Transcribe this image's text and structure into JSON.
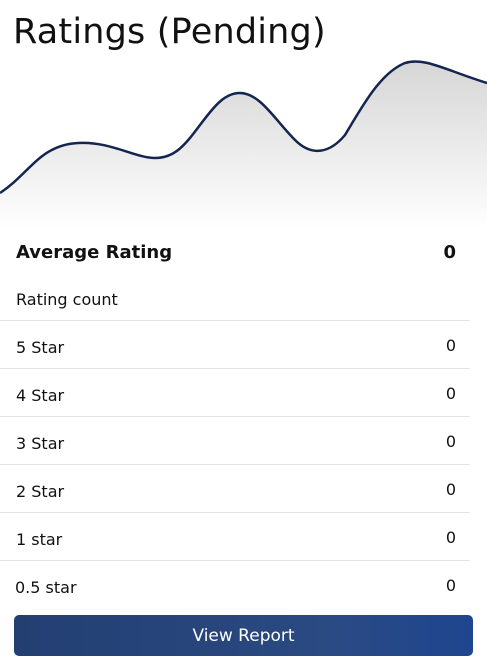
{
  "header": {
    "title": "Ratings (Pending)"
  },
  "summary": {
    "average_label": "Average Rating",
    "average_value": "0",
    "count_label": "Rating count"
  },
  "breakdown": [
    {
      "label": "5 Star",
      "value": "0"
    },
    {
      "label": "4 Star",
      "value": "0"
    },
    {
      "label": "3 Star",
      "value": "0"
    },
    {
      "label": "2 Star",
      "value": "0"
    },
    {
      "label": "1 star",
      "value": "0"
    },
    {
      "label": "0.5 star",
      "value": "0"
    }
  ],
  "actions": {
    "view_report_label": "View Report"
  },
  "colors": {
    "wave_stroke": "#14254f",
    "button_bg": "#233f72",
    "divider": "#e3e3e3"
  }
}
